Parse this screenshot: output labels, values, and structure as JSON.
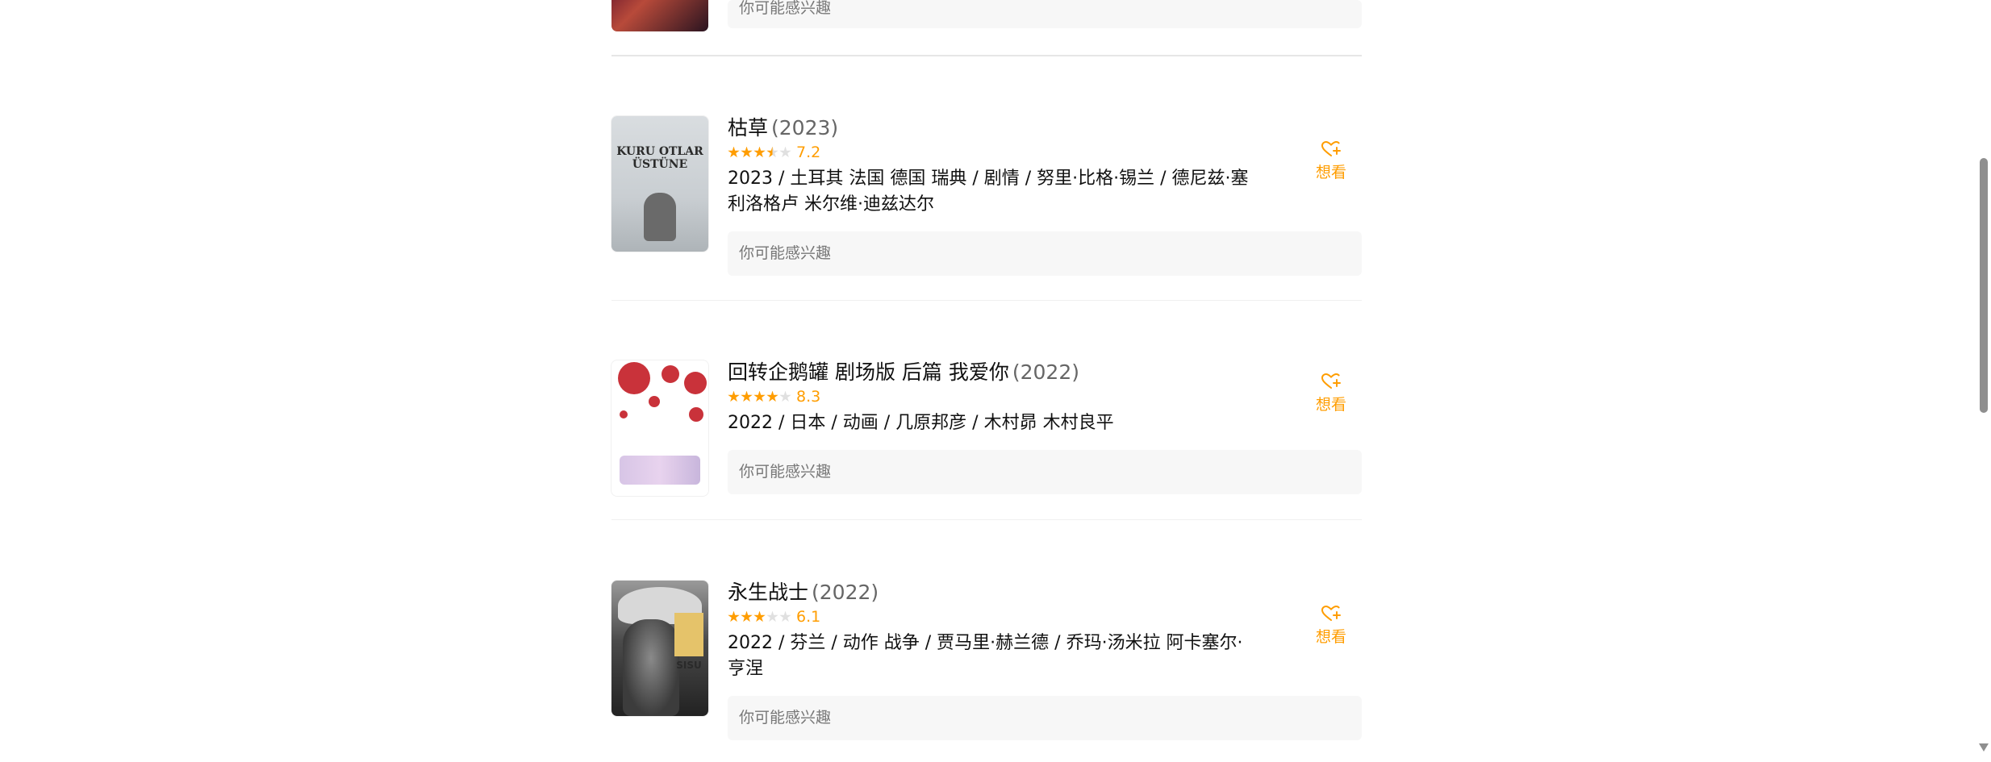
{
  "partial_item": {
    "hint": "你可能感兴趣"
  },
  "movies": [
    {
      "title": "枯草",
      "year": "(2023)",
      "rating": "7.2",
      "stars": 3.5,
      "meta": "2023 / 土耳其 法国 德国 瑞典 / 剧情 / 努里·比格·锡兰 / 德尼兹·塞利洛格卢 米尔维·迪兹达尔",
      "hint": "你可能感兴趣",
      "want_label": "想看",
      "poster_title": "KURU OTLAR ÜSTÜNE",
      "poster_icon": "movie-poster-icon"
    },
    {
      "title": "回转企鹅罐 剧场版 后篇 我爱你",
      "year": "(2022)",
      "rating": "8.3",
      "stars": 4,
      "meta": "2022 / 日本 / 动画 / 几原邦彦 / 木村昴 木村良平",
      "hint": "你可能感兴趣",
      "want_label": "想看",
      "poster_icon": "movie-poster-icon"
    },
    {
      "title": "永生战士",
      "year": "(2022)",
      "rating": "6.1",
      "stars": 3,
      "meta": "2022 / 芬兰 / 动作 战争 / 贾马里·赫兰德 / 乔玛·汤米拉 阿卡塞尔·亨涅",
      "hint": "你可能感兴趣",
      "want_label": "想看",
      "poster_title": "SISU",
      "poster_icon": "movie-poster-icon"
    }
  ],
  "colors": {
    "accent": "#ff9d00",
    "hint_bg": "#f7f7f7",
    "year": "#666666"
  }
}
